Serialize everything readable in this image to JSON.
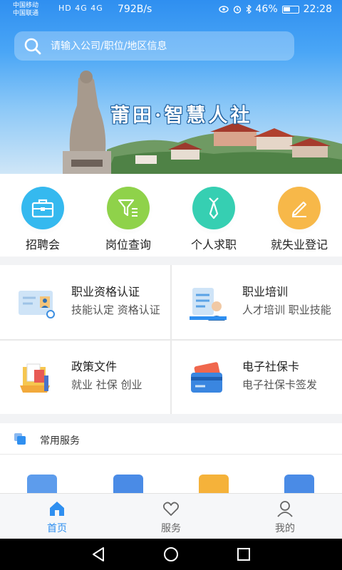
{
  "statusbar": {
    "carrier1": "中国移动",
    "carrier2": "中国联通",
    "net": "HD 4G 4G",
    "speed": "792B/s",
    "battery": "46%",
    "time": "22:28"
  },
  "search": {
    "placeholder": "请输入公司/职位/地区信息"
  },
  "banner": {
    "title": "莆田·智慧人社"
  },
  "quick": [
    {
      "label": "招聘会",
      "icon": "briefcase-icon",
      "color": "#35b9ef"
    },
    {
      "label": "岗位查询",
      "icon": "filter-icon",
      "color": "#8fd24a"
    },
    {
      "label": "个人求职",
      "icon": "tie-icon",
      "color": "#36cfb2"
    },
    {
      "label": "就失业登记",
      "icon": "pencil-icon",
      "color": "#f7b849"
    }
  ],
  "cards": [
    {
      "title": "职业资格认证",
      "desc": "技能认定 资格认证",
      "icon": "certificate-icon"
    },
    {
      "title": "职业培训",
      "desc": "人才培训 职业技能",
      "icon": "training-icon"
    },
    {
      "title": "政策文件",
      "desc": "就业 社保 创业",
      "icon": "document-folder-icon"
    },
    {
      "title": "电子社保卡",
      "desc": "电子社保卡签发",
      "icon": "card-icon"
    }
  ],
  "common": {
    "title": "常用服务"
  },
  "tabs": [
    {
      "label": "首页",
      "icon": "home-icon",
      "active": true
    },
    {
      "label": "服务",
      "icon": "heart-icon",
      "active": false
    },
    {
      "label": "我的",
      "icon": "user-icon",
      "active": false
    }
  ],
  "colors": {
    "accent": "#2f8ff0"
  }
}
